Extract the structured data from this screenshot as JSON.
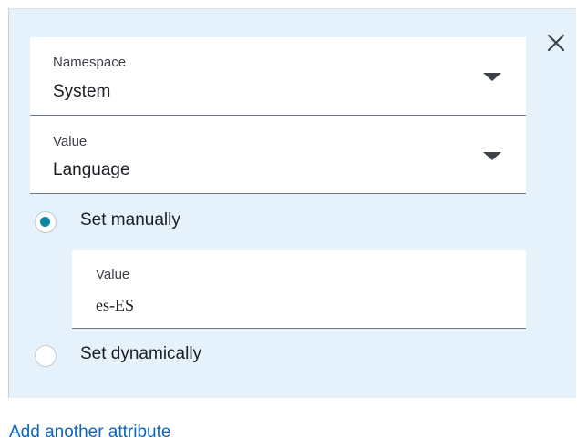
{
  "attribute": {
    "namespace": {
      "label": "Namespace",
      "value": "System"
    },
    "value_select": {
      "label": "Value",
      "value": "Language"
    },
    "options": [
      {
        "label": "Set manually",
        "selected": true
      },
      {
        "label": "Set dynamically",
        "selected": false
      }
    ],
    "manual_value": {
      "label": "Value",
      "value": "es-ES"
    }
  },
  "add_link_label": "Add another attribute",
  "colors": {
    "panel_bg": "#e6f2fb",
    "radio_accent": "#0b87a5",
    "link": "#0b66c2"
  },
  "icons": {
    "close": "close-icon",
    "dropdown": "caret-down-icon"
  }
}
